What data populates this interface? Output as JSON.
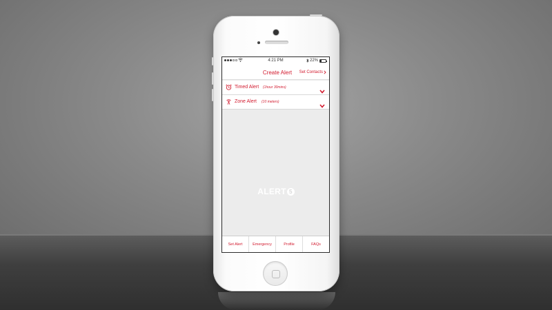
{
  "colors": {
    "accent": "#d21a2e",
    "screen_bg": "#ececec"
  },
  "status_bar": {
    "time": "4:21 PM",
    "battery": "22%",
    "bluetooth_icon": "bluetooth-icon",
    "wifi_icon": "wifi-icon"
  },
  "nav": {
    "title": "Create Alert",
    "right_button": "Set Contacts"
  },
  "alerts": [
    {
      "icon": "alarm-clock-icon",
      "label": "Timed Alert",
      "detail": "(1hour 30mins)"
    },
    {
      "icon": "radio-tower-icon",
      "label": "Zone Alert",
      "detail": "(10 meters)"
    }
  ],
  "logo": {
    "text": "ALERT",
    "badge": "5"
  },
  "tabs": [
    {
      "label": "Set Alert"
    },
    {
      "label": "Emergency"
    },
    {
      "label": "Profile"
    },
    {
      "label": "FAQs"
    }
  ]
}
